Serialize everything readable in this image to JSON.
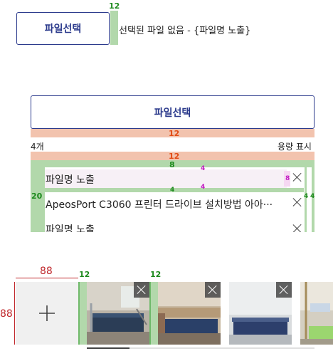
{
  "top": {
    "button_label": "파일선택",
    "gap_label": "12",
    "status_text": "선택된 파일 없음 - {파일명 노출}"
  },
  "mid": {
    "button_label": "파일선택",
    "gap_top": "12",
    "count_text": "4개",
    "size_text": "용량 표시",
    "gap_bottom": "12",
    "left_pad": "8",
    "left_gutter": "20",
    "rows": [
      {
        "name": "파일명 노출"
      },
      {
        "name": "ApeosPort C3060 프린터 드라이브 설치방법 아아···"
      },
      {
        "name": "파일명 노출"
      }
    ],
    "row_gap_a": "4",
    "row_gap_b": "4",
    "row_gap_c": "4",
    "icon_gap": "8",
    "right_gap_a": "4",
    "right_gap_b": "4"
  },
  "bottom": {
    "width_label": "88",
    "height_label": "88",
    "gap_a": "12",
    "gap_b": "12"
  },
  "colors": {
    "accent": "#2b3a8c",
    "guide_green": "#b2d8ab",
    "guide_salmon": "#f2c3ae"
  }
}
